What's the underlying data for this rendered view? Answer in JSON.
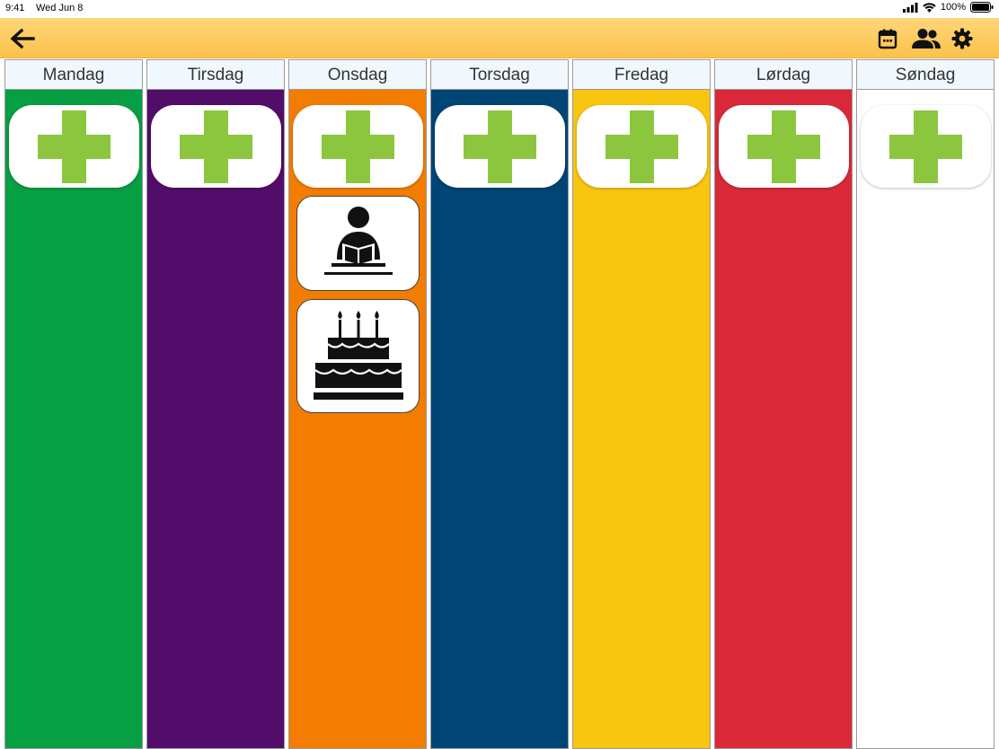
{
  "status_bar": {
    "time": "9:41",
    "date": "Wed Jun 8",
    "battery": "100%"
  },
  "toolbar": {
    "back_icon": "arrow-left-icon",
    "actions": [
      "calendar-icon",
      "people-icon",
      "gear-icon"
    ],
    "background_color": "#fcc24a"
  },
  "week": {
    "days": [
      {
        "label": "Mandag",
        "color": "#079f43",
        "activities": []
      },
      {
        "label": "Tirsdag",
        "color": "#520d6b",
        "activities": []
      },
      {
        "label": "Onsdag",
        "color": "#f37d01",
        "activities": [
          "reading-icon",
          "birthday-cake-icon"
        ]
      },
      {
        "label": "Torsdag",
        "color": "#004575",
        "activities": []
      },
      {
        "label": "Fredag",
        "color": "#f8c511",
        "activities": []
      },
      {
        "label": "Lørdag",
        "color": "#da2939",
        "activities": []
      },
      {
        "label": "Søndag",
        "color": "#ffffff",
        "activities": []
      }
    ],
    "add_icon": "plus-icon",
    "add_icon_color": "#8cc63e"
  }
}
